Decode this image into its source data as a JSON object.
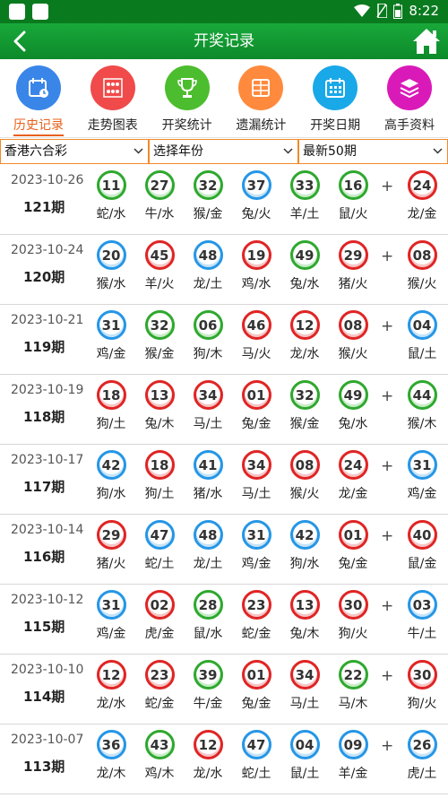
{
  "status_bar": {
    "time": "8:22"
  },
  "header": {
    "title": "开奖记录"
  },
  "nav": [
    {
      "label": "历史记录",
      "icon": "history-calendar-icon",
      "color": "#3a86e8",
      "active": true
    },
    {
      "label": "走势图表",
      "icon": "trend-grid-icon",
      "color": "#f04a4a",
      "active": false
    },
    {
      "label": "开奖统计",
      "icon": "trophy-icon",
      "color": "#4cbd2e",
      "active": false
    },
    {
      "label": "遗漏统计",
      "icon": "table-icon",
      "color": "#ff8a3d",
      "active": false
    },
    {
      "label": "开奖日期",
      "icon": "calendar-icon",
      "color": "#19a8e8",
      "active": false
    },
    {
      "label": "高手资料",
      "icon": "layers-icon",
      "color": "#d91ab8",
      "active": false
    }
  ],
  "filters": {
    "lottery": "香港六合彩",
    "year": "选择年份",
    "range": "最新50期"
  },
  "colors": {
    "red": "#e02424",
    "blue": "#2596e6",
    "green": "#2ea82e",
    "orange": "#f08a2a"
  },
  "draws": [
    {
      "date": "2023-10-26",
      "period": "121期",
      "balls": [
        {
          "num": "11",
          "zodiac": "蛇/水",
          "color": "green"
        },
        {
          "num": "27",
          "zodiac": "牛/水",
          "color": "green"
        },
        {
          "num": "32",
          "zodiac": "猴/金",
          "color": "green"
        },
        {
          "num": "37",
          "zodiac": "兔/火",
          "color": "blue"
        },
        {
          "num": "33",
          "zodiac": "羊/土",
          "color": "green"
        },
        {
          "num": "16",
          "zodiac": "鼠/火",
          "color": "green"
        },
        {
          "num": "24",
          "zodiac": "龙/金",
          "color": "red"
        }
      ]
    },
    {
      "date": "2023-10-24",
      "period": "120期",
      "balls": [
        {
          "num": "20",
          "zodiac": "猴/水",
          "color": "blue"
        },
        {
          "num": "45",
          "zodiac": "羊/火",
          "color": "red"
        },
        {
          "num": "48",
          "zodiac": "龙/土",
          "color": "blue"
        },
        {
          "num": "19",
          "zodiac": "鸡/水",
          "color": "red"
        },
        {
          "num": "49",
          "zodiac": "兔/水",
          "color": "green"
        },
        {
          "num": "29",
          "zodiac": "猪/火",
          "color": "red"
        },
        {
          "num": "08",
          "zodiac": "猴/火",
          "color": "red"
        }
      ]
    },
    {
      "date": "2023-10-21",
      "period": "119期",
      "balls": [
        {
          "num": "31",
          "zodiac": "鸡/金",
          "color": "blue"
        },
        {
          "num": "32",
          "zodiac": "猴/金",
          "color": "green"
        },
        {
          "num": "06",
          "zodiac": "狗/木",
          "color": "green"
        },
        {
          "num": "46",
          "zodiac": "马/火",
          "color": "red"
        },
        {
          "num": "12",
          "zodiac": "龙/水",
          "color": "red"
        },
        {
          "num": "08",
          "zodiac": "猴/火",
          "color": "red"
        },
        {
          "num": "04",
          "zodiac": "鼠/土",
          "color": "blue"
        }
      ]
    },
    {
      "date": "2023-10-19",
      "period": "118期",
      "balls": [
        {
          "num": "18",
          "zodiac": "狗/土",
          "color": "red"
        },
        {
          "num": "13",
          "zodiac": "兔/木",
          "color": "red"
        },
        {
          "num": "34",
          "zodiac": "马/土",
          "color": "red"
        },
        {
          "num": "01",
          "zodiac": "兔/金",
          "color": "red"
        },
        {
          "num": "32",
          "zodiac": "猴/金",
          "color": "green"
        },
        {
          "num": "49",
          "zodiac": "兔/水",
          "color": "green"
        },
        {
          "num": "44",
          "zodiac": "猴/木",
          "color": "green"
        }
      ]
    },
    {
      "date": "2023-10-17",
      "period": "117期",
      "balls": [
        {
          "num": "42",
          "zodiac": "狗/水",
          "color": "blue"
        },
        {
          "num": "18",
          "zodiac": "狗/土",
          "color": "red"
        },
        {
          "num": "41",
          "zodiac": "猪/水",
          "color": "blue"
        },
        {
          "num": "34",
          "zodiac": "马/土",
          "color": "red"
        },
        {
          "num": "08",
          "zodiac": "猴/火",
          "color": "red"
        },
        {
          "num": "24",
          "zodiac": "龙/金",
          "color": "red"
        },
        {
          "num": "31",
          "zodiac": "鸡/金",
          "color": "blue"
        }
      ]
    },
    {
      "date": "2023-10-14",
      "period": "116期",
      "balls": [
        {
          "num": "29",
          "zodiac": "猪/火",
          "color": "red"
        },
        {
          "num": "47",
          "zodiac": "蛇/土",
          "color": "blue"
        },
        {
          "num": "48",
          "zodiac": "龙/土",
          "color": "blue"
        },
        {
          "num": "31",
          "zodiac": "鸡/金",
          "color": "blue"
        },
        {
          "num": "42",
          "zodiac": "狗/水",
          "color": "blue"
        },
        {
          "num": "01",
          "zodiac": "兔/金",
          "color": "red"
        },
        {
          "num": "40",
          "zodiac": "鼠/金",
          "color": "red"
        }
      ]
    },
    {
      "date": "2023-10-12",
      "period": "115期",
      "balls": [
        {
          "num": "31",
          "zodiac": "鸡/金",
          "color": "blue"
        },
        {
          "num": "02",
          "zodiac": "虎/金",
          "color": "red"
        },
        {
          "num": "28",
          "zodiac": "鼠/水",
          "color": "green"
        },
        {
          "num": "23",
          "zodiac": "蛇/金",
          "color": "red"
        },
        {
          "num": "13",
          "zodiac": "兔/木",
          "color": "red"
        },
        {
          "num": "30",
          "zodiac": "狗/火",
          "color": "red"
        },
        {
          "num": "03",
          "zodiac": "牛/土",
          "color": "blue"
        }
      ]
    },
    {
      "date": "2023-10-10",
      "period": "114期",
      "balls": [
        {
          "num": "12",
          "zodiac": "龙/水",
          "color": "red"
        },
        {
          "num": "23",
          "zodiac": "蛇/金",
          "color": "red"
        },
        {
          "num": "39",
          "zodiac": "牛/金",
          "color": "green"
        },
        {
          "num": "01",
          "zodiac": "兔/金",
          "color": "red"
        },
        {
          "num": "34",
          "zodiac": "马/土",
          "color": "red"
        },
        {
          "num": "22",
          "zodiac": "马/木",
          "color": "green"
        },
        {
          "num": "30",
          "zodiac": "狗/火",
          "color": "red"
        }
      ]
    },
    {
      "date": "2023-10-07",
      "period": "113期",
      "balls": [
        {
          "num": "36",
          "zodiac": "龙/木",
          "color": "blue"
        },
        {
          "num": "43",
          "zodiac": "鸡/木",
          "color": "green"
        },
        {
          "num": "12",
          "zodiac": "龙/水",
          "color": "red"
        },
        {
          "num": "47",
          "zodiac": "蛇/土",
          "color": "blue"
        },
        {
          "num": "04",
          "zodiac": "鼠/土",
          "color": "blue"
        },
        {
          "num": "09",
          "zodiac": "羊/金",
          "color": "blue"
        },
        {
          "num": "26",
          "zodiac": "虎/土",
          "color": "blue"
        }
      ]
    }
  ]
}
